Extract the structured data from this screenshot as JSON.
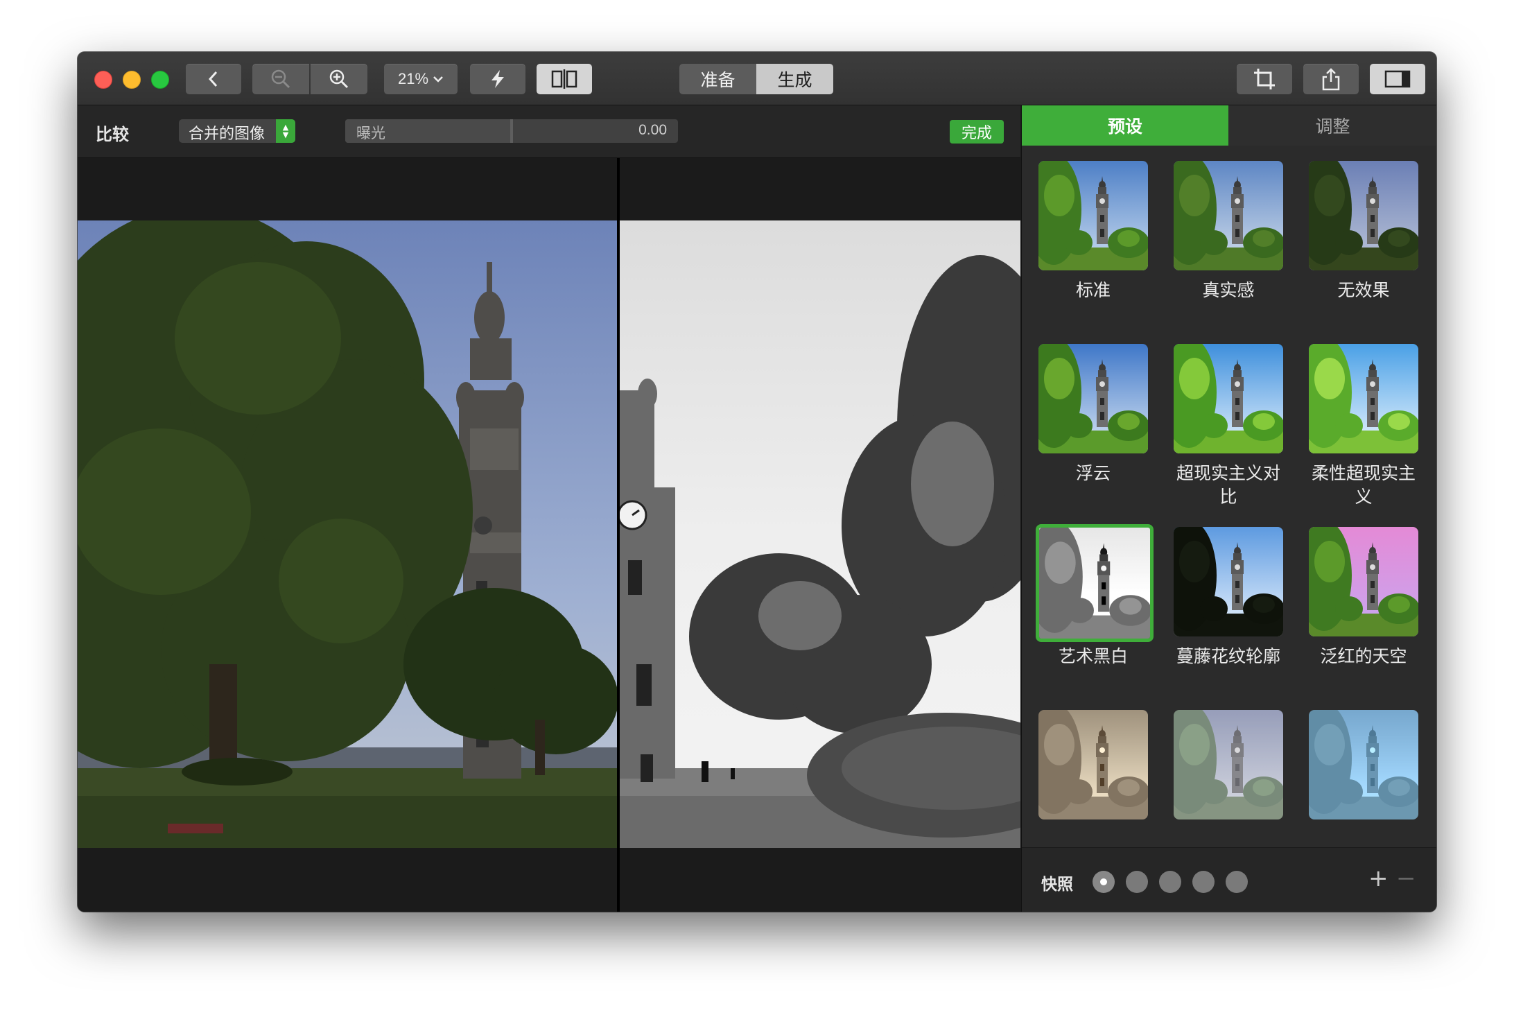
{
  "toolbar": {
    "zoom_value": "21%",
    "mode_tabs": [
      "准备",
      "生成"
    ]
  },
  "compare_bar": {
    "compare_label": "比较",
    "compare_mode": "合并的图像",
    "exposure_label": "曝光",
    "exposure_value": "0.00",
    "done_label": "完成"
  },
  "panel": {
    "tabs": [
      "预设",
      "调整"
    ],
    "presets": [
      {
        "label": "标准",
        "style": "standard"
      },
      {
        "label": "真实感",
        "style": "realistic"
      },
      {
        "label": "无效果",
        "style": "none"
      },
      {
        "label": "浮云",
        "style": "clouds"
      },
      {
        "label": "超现实主义对比",
        "style": "surreal"
      },
      {
        "label": "柔性超现实主义",
        "style": "soft-surreal"
      },
      {
        "label": "艺术黑白",
        "style": "bw",
        "selected": true
      },
      {
        "label": "蔓藤花纹轮廓",
        "style": "silhouette"
      },
      {
        "label": "泛红的天空",
        "style": "pink-sky"
      },
      {
        "label": "",
        "style": "sepia"
      },
      {
        "label": "",
        "style": "faded"
      },
      {
        "label": "",
        "style": "blue"
      }
    ],
    "snapshots_label": "快照",
    "snapshot_count": 5,
    "active_snapshot": 0
  },
  "colors": {
    "accent_green": "#3fae3a",
    "close": "#fe5f57",
    "minimize": "#febc2e",
    "zoom": "#28c840"
  }
}
